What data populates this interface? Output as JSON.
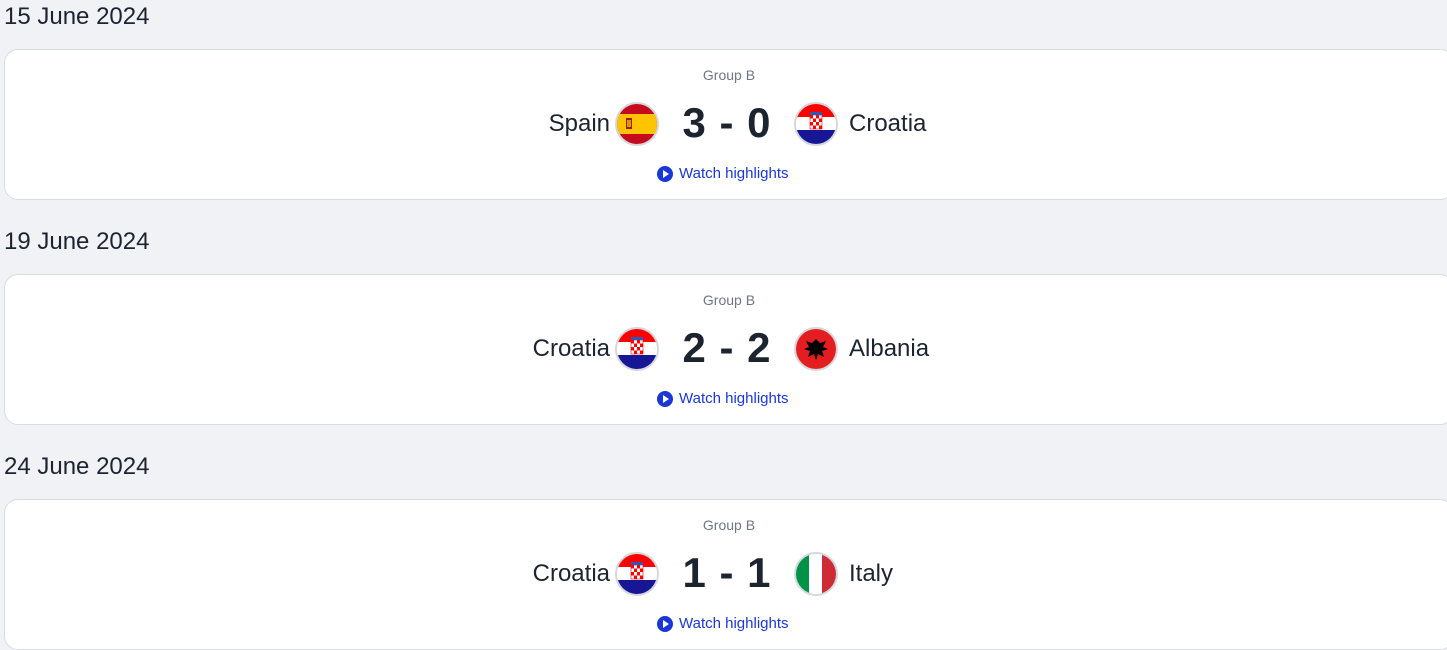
{
  "matches": [
    {
      "date": "15 June 2024",
      "group": "Group B",
      "home": {
        "name": "Spain",
        "flag_icon": "spain-flag-icon"
      },
      "score": "3 - 0",
      "away": {
        "name": "Croatia",
        "flag_icon": "croatia-flag-icon"
      },
      "highlights_label": "Watch highlights"
    },
    {
      "date": "19 June 2024",
      "group": "Group B",
      "home": {
        "name": "Croatia",
        "flag_icon": "croatia-flag-icon"
      },
      "score": "2 - 2",
      "away": {
        "name": "Albania",
        "flag_icon": "albania-flag-icon"
      },
      "highlights_label": "Watch highlights"
    },
    {
      "date": "24 June 2024",
      "group": "Group B",
      "home": {
        "name": "Croatia",
        "flag_icon": "croatia-flag-icon"
      },
      "score": "1 - 1",
      "away": {
        "name": "Italy",
        "flag_icon": "italy-flag-icon"
      },
      "highlights_label": "Watch highlights"
    }
  ],
  "colors": {
    "background": "#f1f2f6",
    "card": "#ffffff",
    "text": "#1c2430",
    "muted": "#6f7684",
    "link": "#1b37d6"
  }
}
